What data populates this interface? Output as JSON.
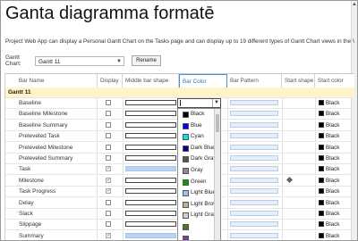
{
  "page": {
    "title": "Ganta diagramma formatē",
    "description": "Project Web App can display a Personal Gantt Chart on the Tasks page and can display up to 19 different types of Gantt Chart views in the View"
  },
  "gantt_chart": {
    "label": "Gantt Chart:",
    "selected": "Gantt 11",
    "rename_label": "Rename"
  },
  "columns": {
    "bar_name": "Bar Name",
    "display": "Display",
    "middle_bar_shape": "Middle bar shape",
    "bar_color": "Bar Color",
    "bar_pattern": "Bar Pattern",
    "start_shape": "Start shape",
    "start_color": "Start color"
  },
  "group": {
    "name": "Gantt 11"
  },
  "rows": [
    {
      "name": "Baseline",
      "display": false,
      "bar": "outline",
      "start_color": "Black"
    },
    {
      "name": "Baseline Milestone",
      "display": false,
      "bar": "outline",
      "start_color": "Black"
    },
    {
      "name": "Baseline Summary",
      "display": false,
      "bar": "outline",
      "start_color": "Black"
    },
    {
      "name": "Preleveled Task",
      "display": false,
      "bar": "outline",
      "start_color": "Black"
    },
    {
      "name": "Preleveled Milestone",
      "display": false,
      "bar": "outline",
      "start_color": "Black"
    },
    {
      "name": "Preleveled Summary",
      "display": false,
      "bar": "outline",
      "start_color": "Black"
    },
    {
      "name": "Task",
      "display": true,
      "bar": "blue",
      "start_color": "Black"
    },
    {
      "name": "Milestone",
      "display": true,
      "bar": "outline",
      "start_shape": "diamond",
      "start_color": "Black"
    },
    {
      "name": "Task Progress",
      "display": true,
      "bar": "outline",
      "start_color": "Black"
    },
    {
      "name": "Delay",
      "display": false,
      "bar": "outline",
      "start_color": "Black"
    },
    {
      "name": "Slack",
      "display": false,
      "bar": "outline",
      "start_color": "Black"
    },
    {
      "name": "Slippage",
      "display": false,
      "bar": "outline",
      "start_color": "Black"
    },
    {
      "name": "Summary",
      "display": true,
      "bar": "blue",
      "start_color": "Black"
    }
  ],
  "color_dropdown": {
    "options": [
      {
        "label": "Black",
        "color": "#000000"
      },
      {
        "label": "Blue",
        "color": "#0000ee"
      },
      {
        "label": "Cyan",
        "color": "#00e5ee"
      },
      {
        "label": "Dark Blue",
        "color": "#00008b"
      },
      {
        "label": "Dark Gray",
        "color": "#555555"
      },
      {
        "label": "Gray",
        "color": "#8c8c8c"
      },
      {
        "label": "Green",
        "color": "#00a000"
      },
      {
        "label": "Light Blue",
        "color": "#9ec5ee"
      },
      {
        "label": "Light Brown",
        "color": "#c9ad86"
      },
      {
        "label": "Light Gray",
        "color": "#d0d0d0"
      },
      {
        "label": "",
        "color": "#4a7a2a"
      },
      {
        "label": "",
        "color": "#7a3ea0"
      }
    ]
  }
}
